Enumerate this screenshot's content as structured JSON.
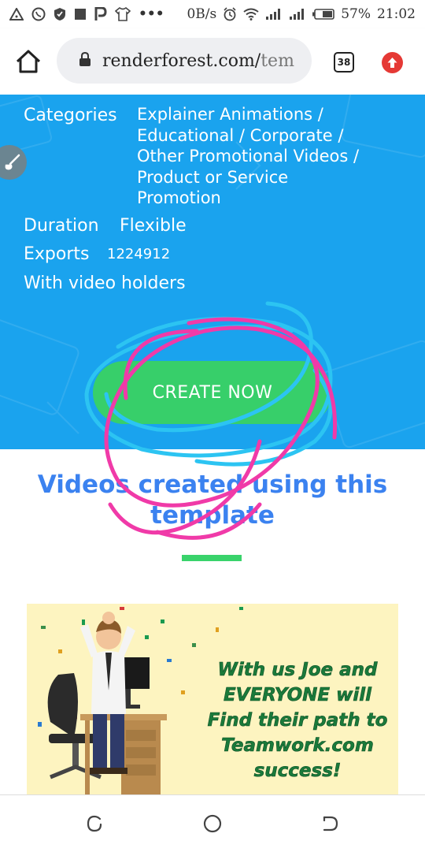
{
  "status_bar": {
    "data_speed": "0B/s",
    "battery": "57%",
    "time": "21:02",
    "more_indicator": "•••"
  },
  "browser": {
    "url_domain": "renderforest.com/",
    "url_path": "tem",
    "tab_count": "38"
  },
  "template_info": {
    "categories_label": "Categories",
    "categories_lines": [
      "Explainer Animations /",
      "Educational / Corporate /",
      "Other Promotional Videos /",
      "Product or Service",
      "Promotion"
    ],
    "duration_label": "Duration",
    "duration_value": "Flexible",
    "exports_label": "Exports",
    "exports_value": "1224912",
    "holders_text": "With video holders"
  },
  "cta": {
    "label": "CREATE NOW"
  },
  "section": {
    "title_line1": "Videos created using this",
    "title_line2": "template"
  },
  "video_card": {
    "lines": [
      "With us Joe and",
      "EVERYONE will",
      "Find their path to",
      "Teamwork.com",
      "success!"
    ]
  },
  "colors": {
    "hero_blue": "#1aa3ee",
    "cta_green": "#37cf6a",
    "heading_blue": "#3b82f0",
    "scribble_pink": "#f03aa8",
    "scribble_cyan": "#2cc4f2"
  }
}
